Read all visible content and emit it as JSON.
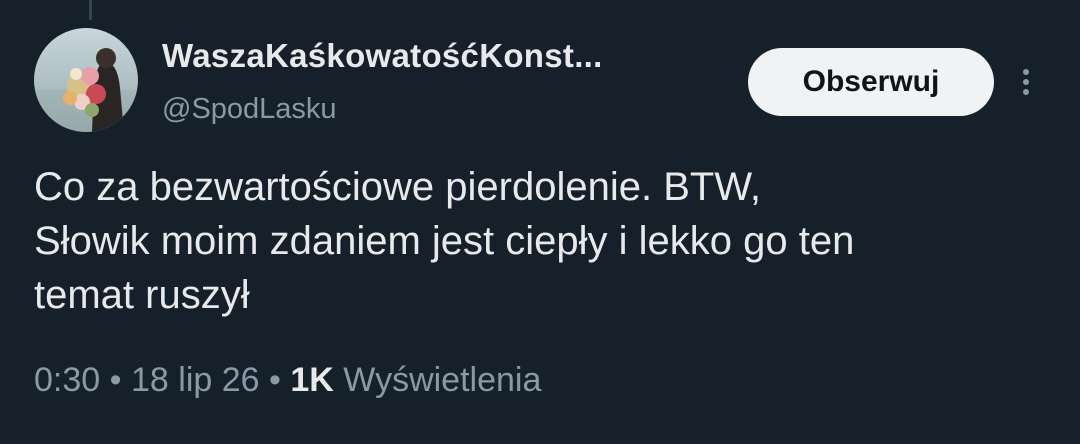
{
  "author": {
    "display_name": "WaszaKaśkowatośćKonst...",
    "handle": "@SpodLasku",
    "avatar_icon": "avatar-photo-flowers"
  },
  "follow_button": {
    "label": "Obserwuj"
  },
  "more_menu": {
    "icon": "more-vertical-icon"
  },
  "tweet": {
    "lines": [
      "Co za bezwartościowe pierdolenie. BTW,",
      "Słowik moim zdaniem jest ciepły i lekko go ten",
      "temat ruszył"
    ]
  },
  "meta": {
    "time": "0:30",
    "separator": "•",
    "date": "18 lip 26",
    "views_count": "1K",
    "views_label": "Wyświetlenia"
  },
  "colors": {
    "background": "#15202b",
    "text": "#e7e9ea",
    "secondary_text": "#8b98a5",
    "button_bg": "#eff3f4"
  }
}
